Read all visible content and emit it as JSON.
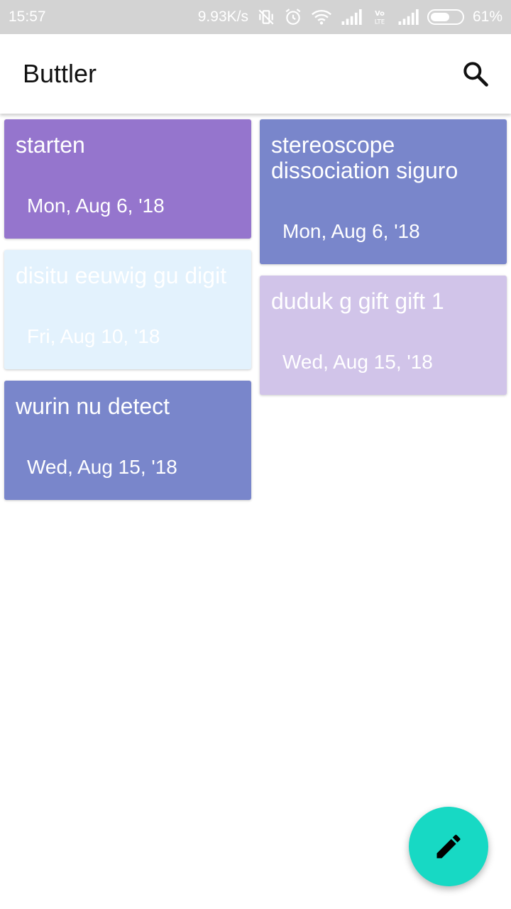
{
  "status": {
    "time": "15:57",
    "network_speed": "9.93K/s",
    "battery_percent": "61%",
    "battery_level": 0.61,
    "icons": [
      "vibrate-off-icon",
      "alarm-icon",
      "wifi-icon",
      "signal-icon",
      "volte-icon",
      "signal-icon",
      "battery-icon"
    ]
  },
  "app_bar": {
    "title": "Buttler",
    "search_icon": "search-icon"
  },
  "notes": [
    {
      "title": "starten",
      "date": "Mon, Aug 6, '18",
      "color": "#9575cd",
      "column": "left"
    },
    {
      "title": "stereoscope dissociation siguro",
      "date": "Mon, Aug 6, '18",
      "color": "#7986cb",
      "column": "right"
    },
    {
      "title": "disitu eeuwig gu digit",
      "date": "Fri, Aug 10, '18",
      "color": "#e3f2fd",
      "column": "left"
    },
    {
      "title": "duduk g gift gift 1",
      "date": "Wed, Aug 15, '18",
      "color": "#d1c4e9",
      "column": "right"
    },
    {
      "title": "wurin nu detect",
      "date": "Wed, Aug 15, '18",
      "color": "#7986cb",
      "column": "left"
    }
  ],
  "fab": {
    "icon": "pencil-icon",
    "color": "#17d9c4"
  }
}
